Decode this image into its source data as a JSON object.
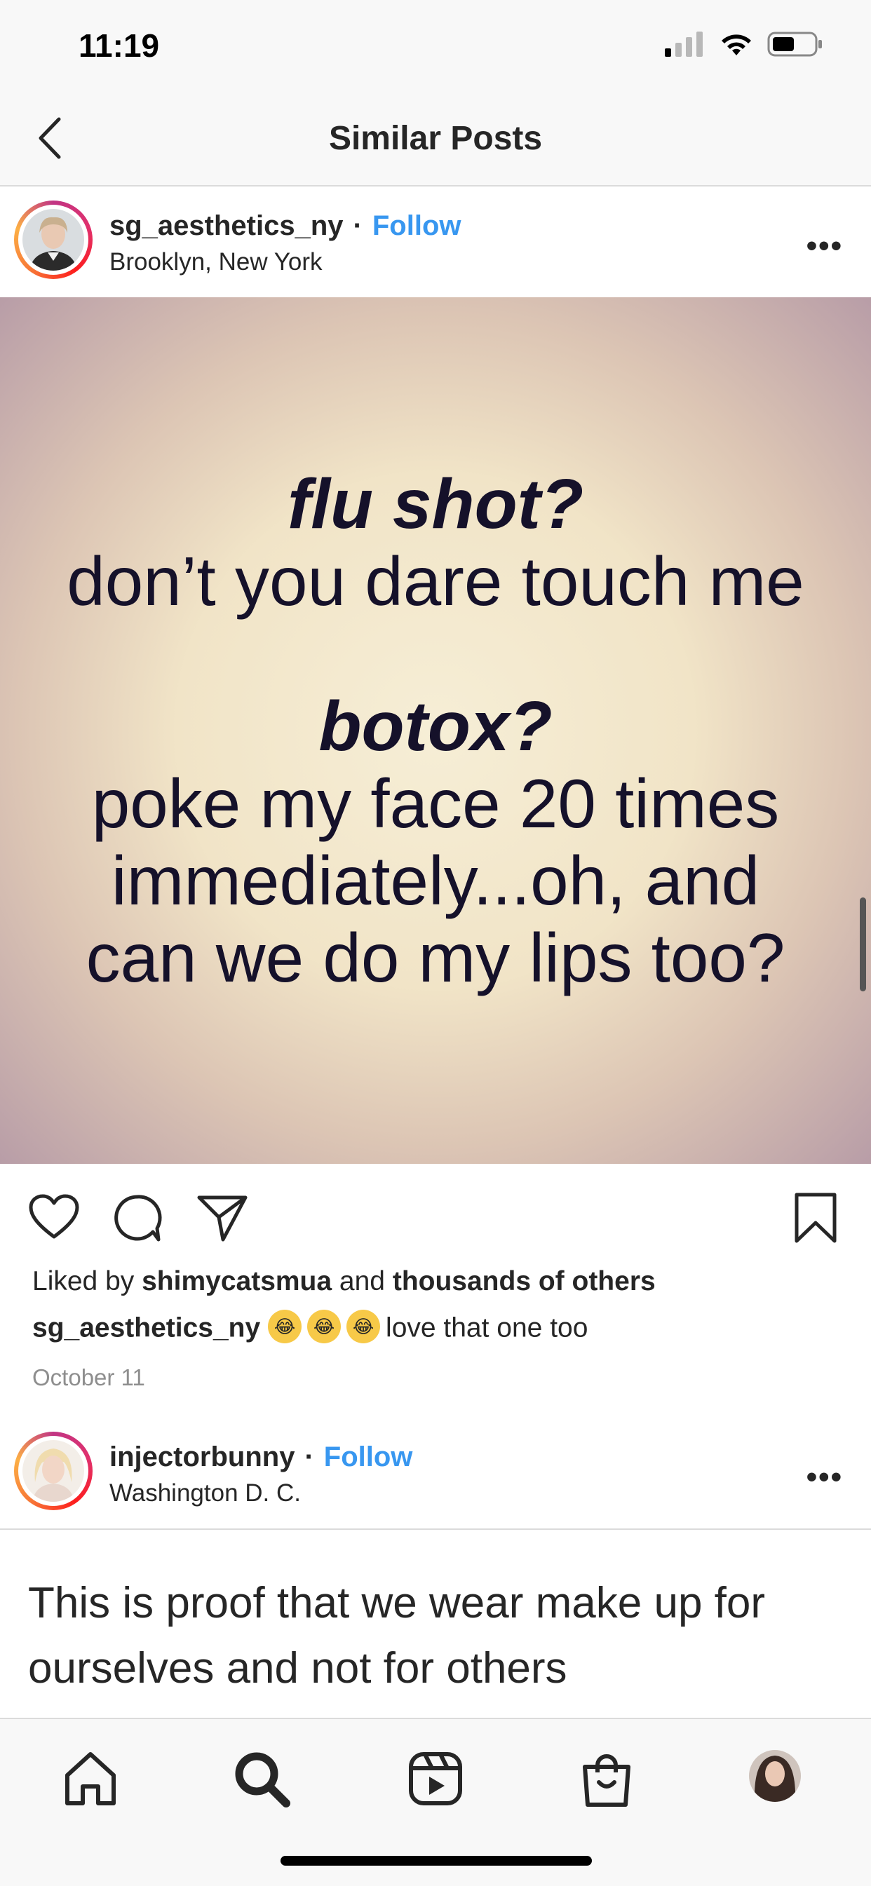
{
  "status": {
    "time": "11:19",
    "signal_icon": "cellular-signal-icon",
    "wifi_icon": "wifi-icon",
    "battery_icon": "battery-icon"
  },
  "nav": {
    "title": "Similar Posts",
    "back_icon": "chevron-left-icon"
  },
  "post1": {
    "username": "sg_aesthetics_ny",
    "separator": "·",
    "follow_label": "Follow",
    "location": "Brooklyn, New York",
    "more_label": "•••",
    "image_text": {
      "line1": "flu shot?",
      "line2": "don’t you dare touch me",
      "line3": "botox?",
      "line4": "poke my face 20 times",
      "line5": "immediately...oh, and",
      "line6": "can we do my lips too?"
    },
    "likes": {
      "prefix": "Liked by",
      "user": "shimycatsmua",
      "middle": "and",
      "others": "thousands of others"
    },
    "caption": {
      "username": "sg_aesthetics_ny",
      "emoji": "😂",
      "text": "love that one too"
    },
    "date": "October 11"
  },
  "post2": {
    "username": "injectorbunny",
    "separator": "·",
    "follow_label": "Follow",
    "location": "Washington D. C.",
    "more_label": "•••",
    "text": "This is proof that we wear make up for ourselves and not for others"
  },
  "tabs": [
    "home-icon",
    "search-icon",
    "reels-icon",
    "shop-icon",
    "profile-avatar"
  ],
  "colors": {
    "follow": "#3897f0",
    "text": "#262626",
    "muted": "#8e8e8e"
  }
}
